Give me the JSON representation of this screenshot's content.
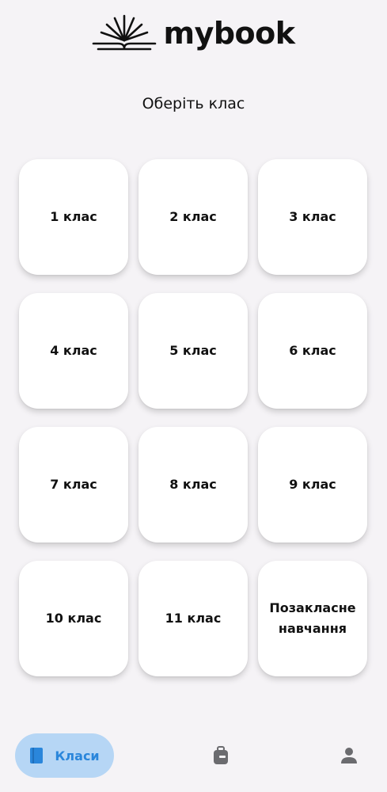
{
  "logo": {
    "text": "mybook"
  },
  "page": {
    "subtitle": "Оберіть клас"
  },
  "grades": [
    "1 клас",
    "2 клас",
    "3 клас",
    "4 клас",
    "5 клас",
    "6 клас",
    "7 клас",
    "8 клас",
    "9 клас",
    "10 клас",
    "11 клас",
    "Позакласне навчання"
  ],
  "nav": {
    "active_label": "Класи",
    "items": [
      "book-icon",
      "backpack-icon",
      "person-icon"
    ]
  },
  "colors": {
    "background": "#f5f3f6",
    "accent": "#2a86db",
    "accent_bg": "#b6d6f5",
    "icon_gray": "#6b6b6f"
  }
}
